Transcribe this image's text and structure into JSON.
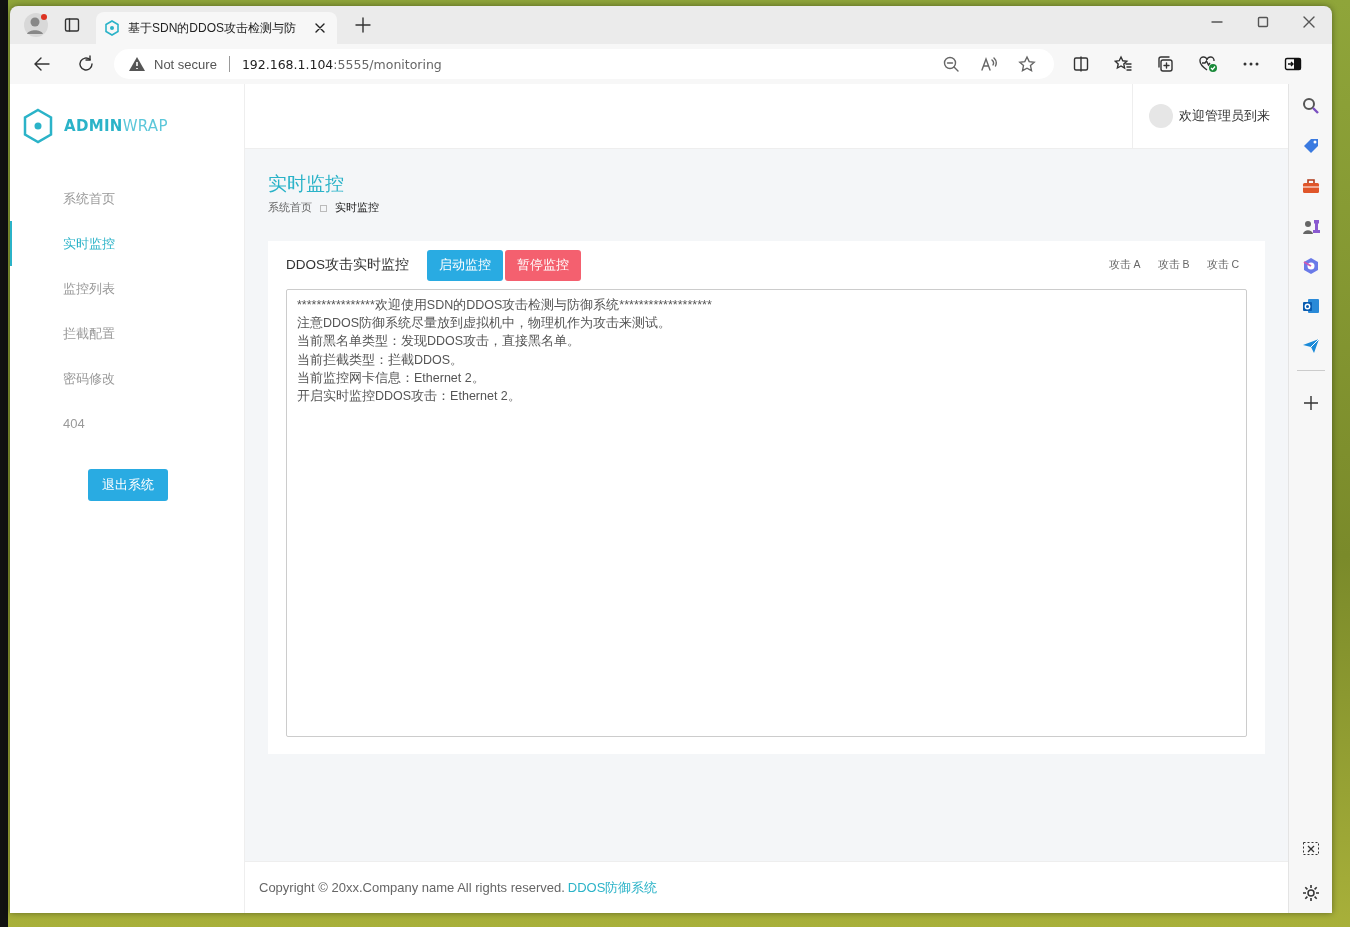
{
  "browser": {
    "tab": {
      "title": "基于SDN的DDOS攻击检测与防"
    },
    "address_bar": {
      "security": "Not secure",
      "host": "192.168.1.104",
      "path": ":5555/monitoring"
    }
  },
  "sidebar": {
    "logo": {
      "strong": "ADMIN",
      "light": "WRAP"
    },
    "items": [
      {
        "label": "系统首页",
        "selected": false
      },
      {
        "label": "实时监控",
        "selected": true
      },
      {
        "label": "监控列表",
        "selected": false
      },
      {
        "label": "拦截配置",
        "selected": false
      },
      {
        "label": "密码修改",
        "selected": false
      },
      {
        "label": "404",
        "selected": false
      }
    ],
    "logout_button": "退出系统"
  },
  "header": {
    "welcome": "欢迎管理员到来"
  },
  "page": {
    "title": "实时监控",
    "breadcrumb": [
      {
        "label": "系统首页",
        "current": false
      },
      {
        "label": "实时监控",
        "current": true
      }
    ]
  },
  "card": {
    "title": "DDOS攻击实时监控",
    "buttons": [
      {
        "label": "启动监控",
        "kind": "primary"
      },
      {
        "label": "暂停监控",
        "kind": "danger"
      }
    ],
    "links": [
      "攻击 A",
      "攻击 B",
      "攻击 C"
    ],
    "log_lines": [
      "****************欢迎使用SDN的DDOS攻击检测与防御系统*******************",
      "注意DDOS防御系统尽量放到虚拟机中，物理机作为攻击来测试。",
      "当前黑名单类型：发现DDOS攻击，直接黑名单。",
      "当前拦截类型：拦截DDOS。",
      "当前监控网卡信息：Ethernet 2。",
      "开启实时监控DDOS攻击：Ethernet 2。"
    ]
  },
  "footer": {
    "copyright": "Copyright © 20xx.Company name All rights reserved.",
    "link": "DDOS防御系统"
  }
}
